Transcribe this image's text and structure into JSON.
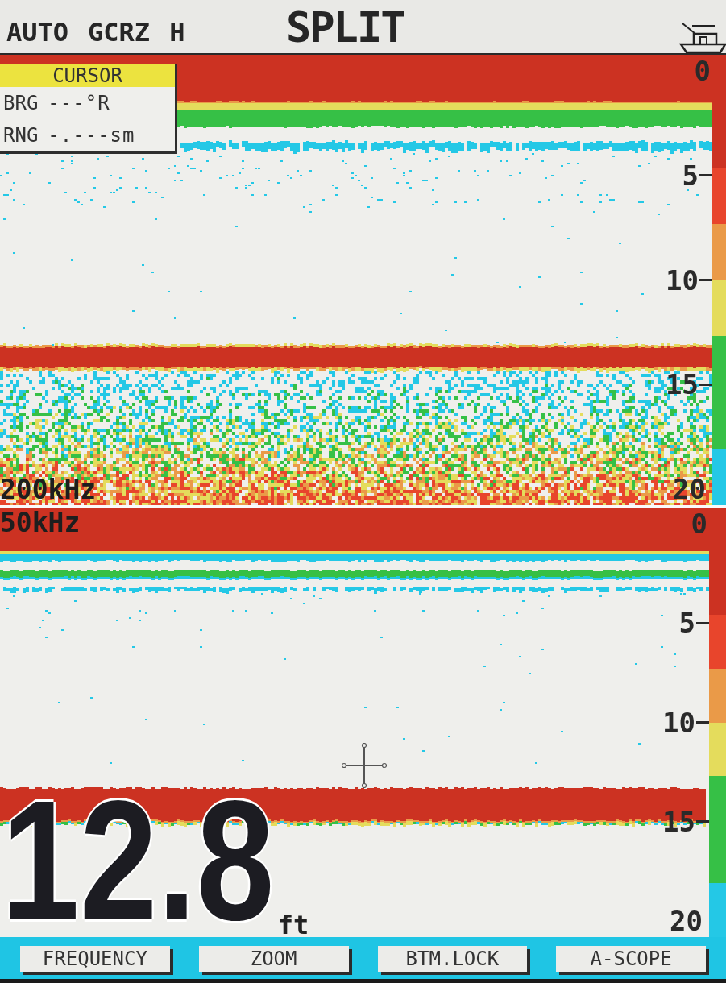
{
  "header": {
    "status": [
      "AUTO",
      "GCRZ",
      "H"
    ],
    "mode": "SPLIT"
  },
  "upper_panel": {
    "cursor": {
      "title": "CURSOR",
      "rows": [
        {
          "label": "BRG",
          "value": "---°R"
        },
        {
          "label": "RNG",
          "value": "-.---sm"
        }
      ]
    },
    "frequency": "200kHz",
    "depth_scale": [
      "0",
      "5",
      "10",
      "15",
      "20"
    ],
    "color_scale": [
      {
        "color": "#cc3222"
      },
      {
        "color": "#e8452c"
      },
      {
        "color": "#ea9a48"
      },
      {
        "color": "#e4dc5c"
      },
      {
        "color": "#36c046"
      },
      {
        "color": "#24c8e6"
      }
    ]
  },
  "lower_panel": {
    "frequency": "50kHz",
    "depth_scale": [
      "0",
      "5",
      "10",
      "15",
      "20"
    ],
    "color_scale": [
      {
        "color": "#cc3222"
      },
      {
        "color": "#e8452c"
      },
      {
        "color": "#ea9a48"
      },
      {
        "color": "#e4dc5c"
      },
      {
        "color": "#36c046"
      },
      {
        "color": "#24c8e6"
      }
    ],
    "depth": {
      "value": "12.8",
      "unit": "ft"
    }
  },
  "softkeys": [
    "FREQUENCY",
    "ZOOM",
    "BTM.LOCK",
    "A-SCOPE"
  ]
}
